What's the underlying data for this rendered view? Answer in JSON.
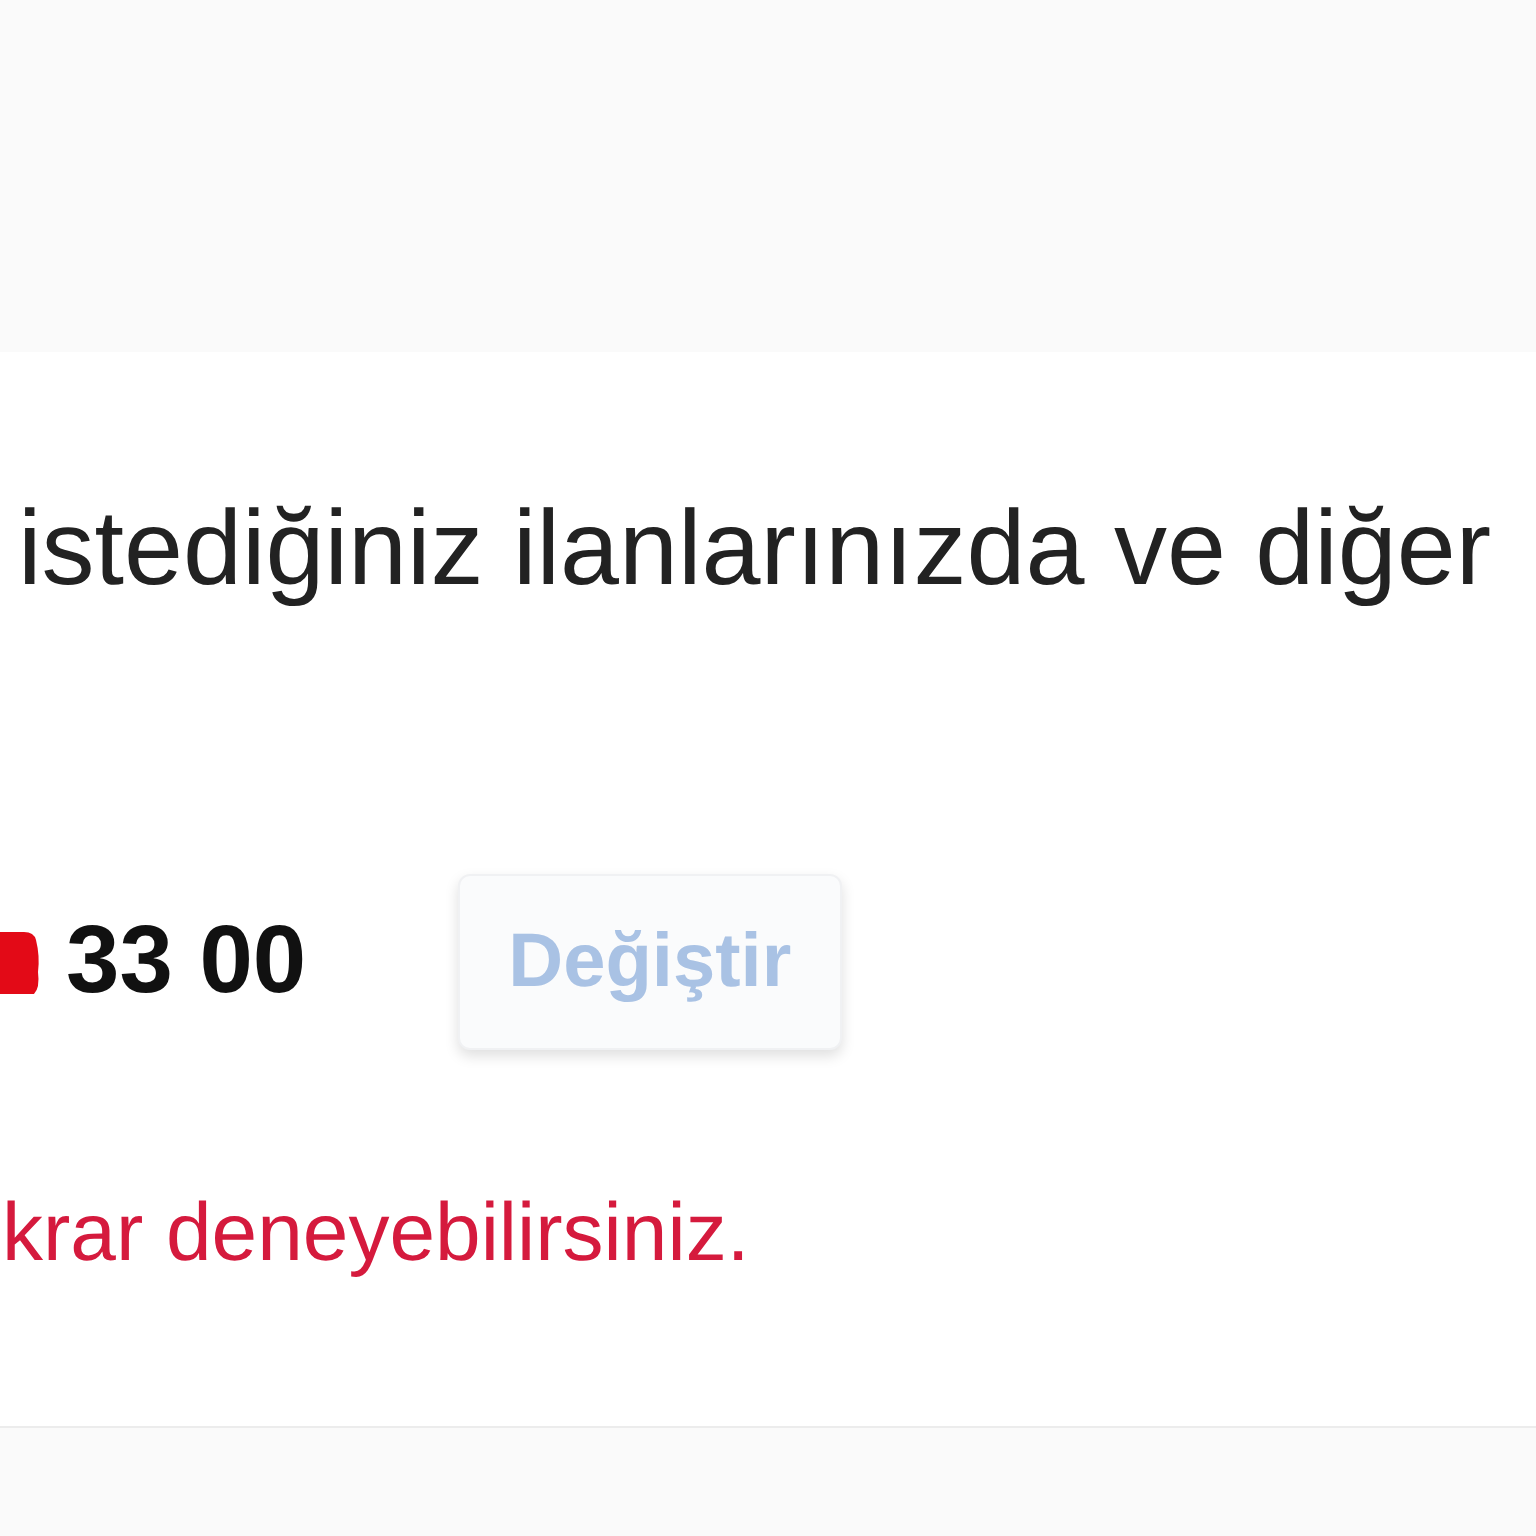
{
  "intro_text": "istediğiniz ilanlarınızda ve diğer",
  "phone": {
    "number": "33 00",
    "change_button": {
      "label": "Değiştir",
      "disabled": true
    }
  },
  "error_message": "krar deneyebilirsiniz."
}
